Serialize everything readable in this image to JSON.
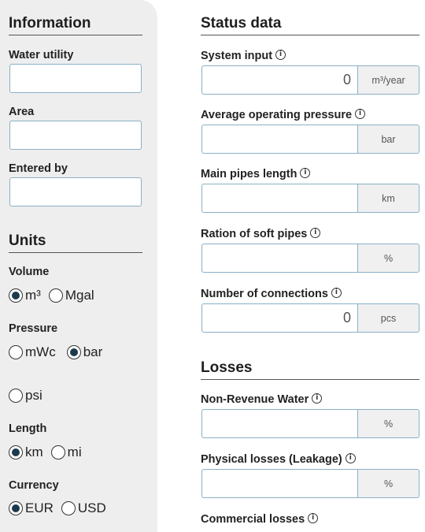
{
  "information": {
    "title": "Information",
    "water_utility_label": "Water utility",
    "water_utility_value": "",
    "area_label": "Area",
    "area_value": "",
    "entered_by_label": "Entered by",
    "entered_by_value": ""
  },
  "units": {
    "title": "Units",
    "volume": {
      "label": "Volume",
      "options": [
        "m³",
        "Mgal"
      ],
      "selected": "m³"
    },
    "pressure": {
      "label": "Pressure",
      "options": [
        "mWc",
        "bar",
        "psi"
      ],
      "selected": "bar"
    },
    "length": {
      "label": "Length",
      "options": [
        "km",
        "mi"
      ],
      "selected": "km"
    },
    "currency": {
      "label": "Currency",
      "options": [
        "EUR",
        "USD"
      ],
      "selected": "EUR"
    }
  },
  "status": {
    "title": "Status data",
    "system_input": {
      "label": "System input",
      "value": "0",
      "unit": "m³/year"
    },
    "avg_pressure": {
      "label": "Average operating pressure",
      "value": "",
      "unit": "bar"
    },
    "main_pipes_length": {
      "label": "Main pipes length",
      "value": "",
      "unit": "km"
    },
    "soft_pipes_ratio": {
      "label": "Ration of soft pipes",
      "value": "",
      "unit": "%"
    },
    "connections": {
      "label": "Number of connections",
      "value": "0",
      "unit": "pcs"
    }
  },
  "losses": {
    "title": "Losses",
    "non_revenue_water": {
      "label": "Non-Revenue Water",
      "value": "",
      "unit": "%"
    },
    "physical_losses": {
      "label": "Physical losses (Leakage)",
      "value": "",
      "unit": "%"
    },
    "commercial_losses": {
      "label": "Commercial losses"
    }
  },
  "icons": {
    "info": "i"
  },
  "colors": {
    "sidebar_bg": "#eeeeee",
    "input_border": "#8ab0c7",
    "unit_bg": "#f0f0f0",
    "radio_fill": "#1b3a4b"
  }
}
